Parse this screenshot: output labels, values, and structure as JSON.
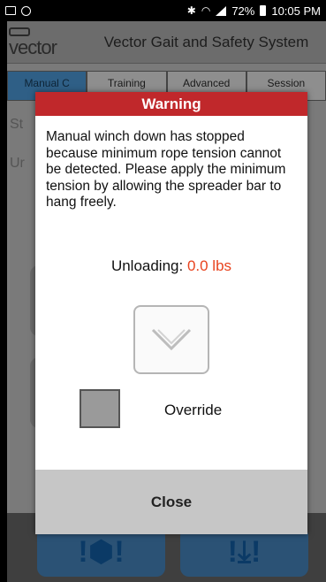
{
  "status_bar": {
    "battery": "72%",
    "time": "10:05 PM",
    "icons": [
      "photo-icon",
      "circle-icon",
      "bluetooth-icon",
      "wifi-icon",
      "signal-icon",
      "battery-icon"
    ]
  },
  "app": {
    "logo": "vector",
    "title": "Vector Gait and Safety System",
    "tabs": [
      {
        "label": "Manual C"
      },
      {
        "label": "Training"
      },
      {
        "label": "Advanced"
      },
      {
        "label": "Session"
      }
    ],
    "bg_labels": [
      "St",
      "Ur"
    ],
    "bottom_buttons": [
      {
        "label": "!⬢!",
        "icon": "stop-icon"
      },
      {
        "label": "!⤓!",
        "icon": "unload-icon"
      }
    ]
  },
  "dialog": {
    "title": "Warning",
    "message": "Manual winch down has stopped because minimum rope tension cannot be detected. Please apply the minimum tension by allowing the spreader bar to hang freely.",
    "unloading_label": "Unloading:",
    "unloading_value": "0.0 lbs",
    "override_label": "Override",
    "close_label": "Close",
    "colors": {
      "title_bg": "#c0282b",
      "value": "#e8431e"
    }
  }
}
